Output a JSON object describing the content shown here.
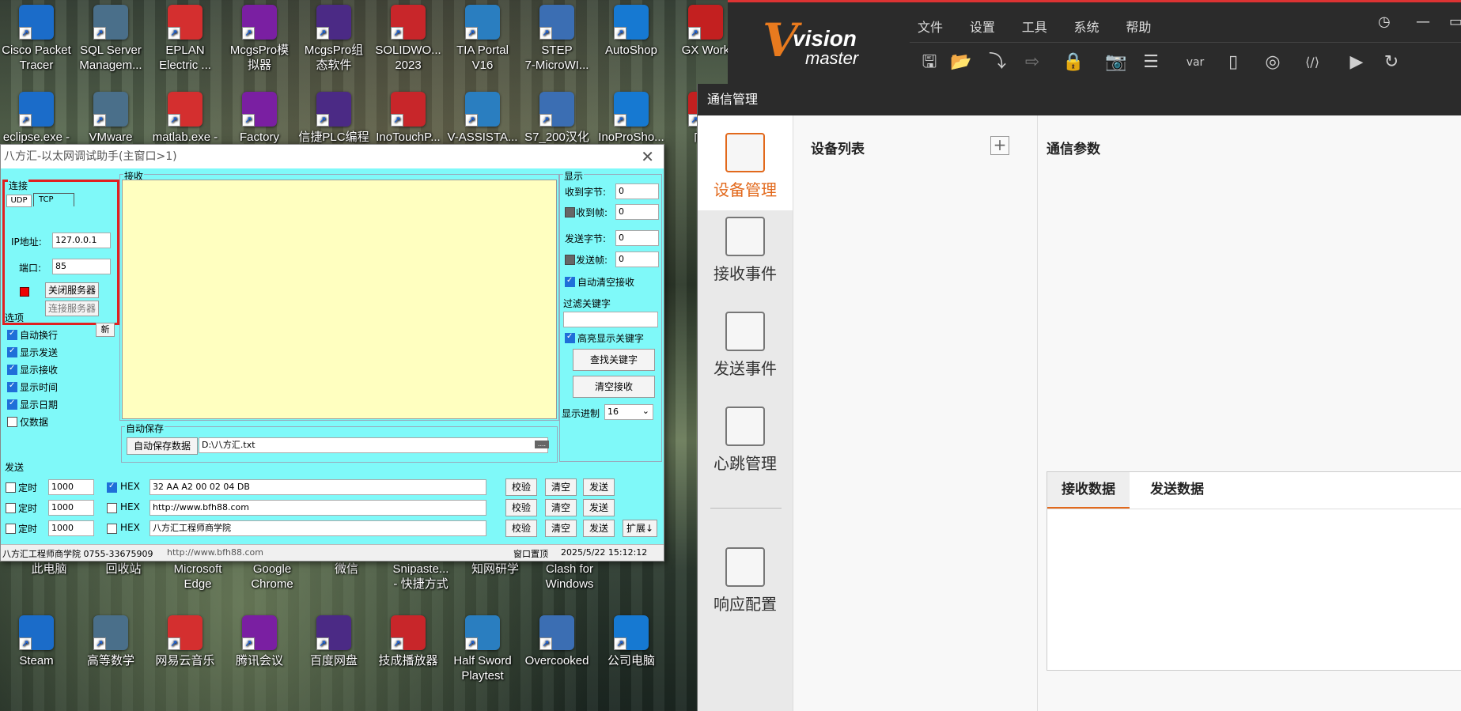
{
  "desktop": {
    "row1": [
      "Cisco Packet\nTracer",
      "SQL Server\nManagem...",
      "EPLAN\nElectric ...",
      "McgsPro模\n拟器",
      "McgsPro组\n态软件",
      "SOLIDWO...\n2023",
      "TIA Portal\nV16",
      "STEP\n7-MicroWI...",
      "AutoShop",
      "GX Work"
    ],
    "row2": [
      "eclipse.exe -",
      "VMware",
      "matlab.exe -",
      "Factory",
      "信捷PLC编程",
      "InoTouchP...",
      "V-ASSISTA...",
      "S7_200汉化",
      "InoProSho...",
      "向日"
    ],
    "row3": [
      "此电脑",
      "回收站",
      "Microsoft\nEdge",
      "Google\nChrome",
      "微信",
      "Snipaste...\n- 快捷方式",
      "知网研学",
      "Clash for\nWindows"
    ],
    "row4": [
      "Steam",
      "高等数学",
      "网易云音乐",
      "腾讯会议",
      "百度网盘",
      "技成播放器",
      "Half Sword\nPlaytest",
      "Overcooked",
      "公司电脑"
    ]
  },
  "tool": {
    "title": "八方汇-以太网调试助手(主窗口>1)",
    "conn_group": "连接",
    "tab_udp": "UDP",
    "tab_tcp": "TCP",
    "ip_label": "IP地址:",
    "ip_value": "127.0.0.1",
    "port_label": "端口:",
    "port_value": "85",
    "close_server": "关闭服务器",
    "connect_server": "连接服务器",
    "options_group": "选项",
    "new_btn": "新",
    "options": [
      "自动换行",
      "显示发送",
      "显示接收",
      "显示时间",
      "显示日期",
      "仅数据"
    ],
    "recv_group": "接收",
    "autosave_group": "自动保存",
    "autosave_btn": "自动保存数据",
    "autosave_path": "D:\\八方汇.txt",
    "browse": "....",
    "display_group": "显示",
    "recv_bytes_label": "收到字节:",
    "recv_bytes": "0",
    "recv_frames_label": "收到帧:",
    "recv_frames": "0",
    "send_bytes_label": "发送字节:",
    "send_bytes": "0",
    "send_frames_label": "发送帧:",
    "send_frames": "0",
    "auto_clear": "自动清空接收",
    "filter_label": "过滤关键字",
    "highlight": "高亮显示关键字",
    "find_key": "查找关键字",
    "clear_recv": "清空接收",
    "radix_label": "显示进制",
    "radix_value": "16",
    "send_group": "发送",
    "timer_label": "定时",
    "hex_label": "HEX",
    "send_rows": [
      {
        "interval": "1000",
        "text": "32 AA A2 00 02 04 DB"
      },
      {
        "interval": "1000",
        "text": "http://www.bfh88.com"
      },
      {
        "interval": "1000",
        "text": "八方汇工程师商学院"
      }
    ],
    "verify": "校验",
    "clear": "清空",
    "send": "发送",
    "expand": "扩展↓",
    "status_company": "八方汇工程师商学院  0755-33675909",
    "status_url": "http://www.bfh88.com",
    "status_top": "窗口置顶",
    "status_time": "2025/5/22 15:12:12"
  },
  "vm": {
    "logo_v": "V",
    "logo_t1": "vision",
    "logo_t2": "master",
    "menu": [
      "文件",
      "设置",
      "工具",
      "系统",
      "帮助"
    ],
    "window_title": "通信管理",
    "side": [
      "设备管理",
      "接收事件",
      "发送事件",
      "心跳管理",
      "响应配置"
    ],
    "device_list": "设备列表",
    "comm_params": "通信参数",
    "tab_recv": "接收数据",
    "tab_send": "发送数据"
  },
  "colors": {
    "accent": "#e2691c",
    "tool_bg": "#7ff9f9",
    "recv_bg": "#ffffc0"
  }
}
